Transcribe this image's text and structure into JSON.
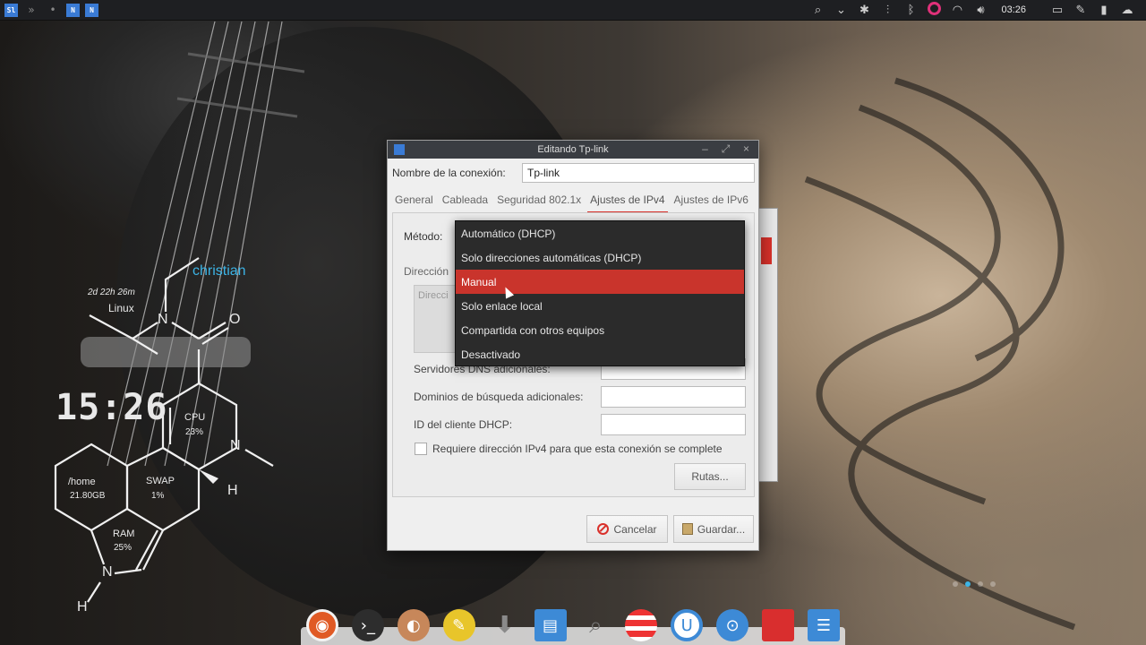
{
  "top_panel": {
    "app_icons": [
      "Sl",
      "N",
      "N"
    ],
    "clock": "03:26"
  },
  "conky": {
    "user": "christian",
    "uptime": "2d 22h 26m",
    "os": "Linux",
    "clock": "15:26",
    "cpu_label": "CPU",
    "cpu_value": "23%",
    "home_label": "/home",
    "home_value": "21.80GB",
    "swap_label": "SWAP",
    "swap_value": "1%",
    "ram_label": "RAM",
    "ram_value": "25%",
    "atoms": {
      "n1": "N",
      "o1": "O",
      "n2": "N",
      "h1": "H",
      "n3": "N",
      "h2": "H"
    }
  },
  "dialog": {
    "title": "Editando Tp-link",
    "connection_name_label": "Nombre de la conexión:",
    "connection_name_value": "Tp-link",
    "tabs": [
      {
        "label": "General",
        "active": false
      },
      {
        "label": "Cableada",
        "active": false
      },
      {
        "label": "Seguridad 802.1x",
        "active": false
      },
      {
        "label": "Ajustes de IPv4",
        "active": true
      },
      {
        "label": "Ajustes de IPv6",
        "active": false
      }
    ],
    "method_label": "Método:",
    "addresses_label": "Dirección",
    "addresses_column": "Direcci",
    "dns_label": "Servidores DNS adicionales:",
    "search_domains_label": "Dominios de búsqueda adicionales:",
    "dhcp_client_id_label": "ID del cliente DHCP:",
    "require_ipv4_label": "Requiere dirección IPv4 para que esta conexión se complete",
    "routes_button": "Rutas...",
    "cancel_button": "Cancelar",
    "save_button": "Guardar..."
  },
  "method_dropdown": {
    "options": [
      "Automático (DHCP)",
      "Solo direcciones automáticas (DHCP)",
      "Manual",
      "Solo enlace local",
      "Compartida con otros equipos",
      "Desactivado"
    ],
    "selected": "Manual"
  },
  "colors": {
    "accent": "#c9342c",
    "conky_user": "#3cb4e6"
  }
}
